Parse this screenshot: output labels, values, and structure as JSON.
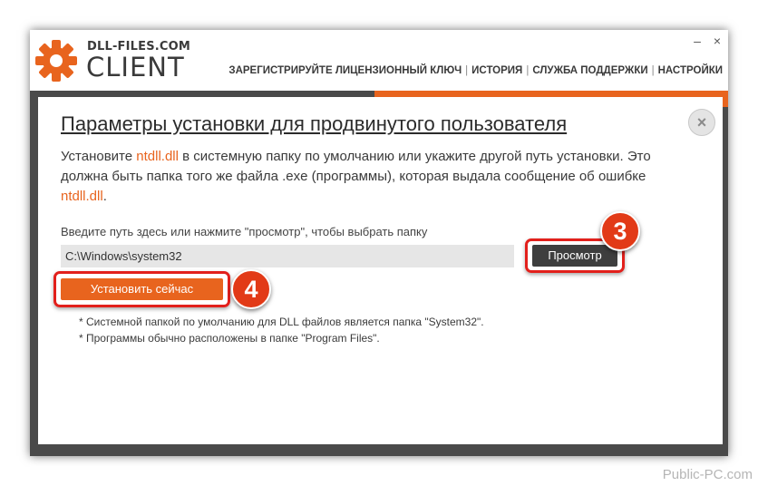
{
  "app": {
    "logo_top": "DLL-FILES.COM",
    "logo_bottom": "CLIENT"
  },
  "window_controls": {
    "minimize": "–",
    "close": "×"
  },
  "nav": {
    "items": [
      "ЗАРЕГИСТРИРУЙТЕ ЛИЦЕНЗИОННЫЙ КЛЮЧ",
      "ИСТОРИЯ",
      "СЛУЖБА ПОДДЕРЖКИ",
      "НАСТРОЙКИ"
    ],
    "separator": "|"
  },
  "dialog": {
    "title": "Параметры установки для продвинутого пользователя",
    "close_glyph": "×",
    "desc": {
      "p1": "Установите ",
      "file1": "ntdll.dll",
      "p2": " в системную папку по умолчанию или укажите другой путь установки. Это должна быть папка того же файла .exe (программы), которая выдала сообщение об ошибке ",
      "file2": "ntdll.dll",
      "p3": "."
    },
    "path_label": "Введите путь здесь или нажмите \"просмотр\", чтобы выбрать папку",
    "path_value": "C:\\Windows\\system32",
    "browse_label": "Просмотр",
    "install_label": "Установить сейчас",
    "notes": [
      "* Системной папкой по умолчанию для DLL файлов является папка \"System32\".",
      "* Программы обычно расположены в папке \"Program Files\"."
    ]
  },
  "badges": {
    "browse_step": "3",
    "install_step": "4"
  },
  "watermark": "Public-PC.com",
  "colors": {
    "accent": "#e8641e",
    "highlight_outline": "#e2201c",
    "badge": "#e23a17",
    "dark_button": "#3e3e3e",
    "window_frame": "#4a4a4a"
  }
}
